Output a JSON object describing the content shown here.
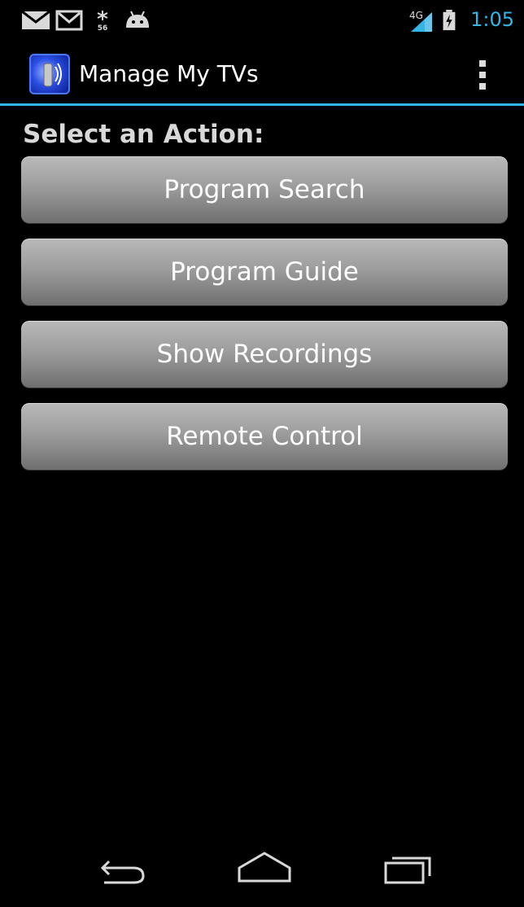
{
  "status_bar": {
    "time": "1:05",
    "network_label": "4G",
    "icons": [
      "gmail-envelope-icon",
      "gmail-m-icon",
      "weather-icon",
      "android-icon",
      "signal-icon",
      "battery-charging-icon"
    ]
  },
  "action_bar": {
    "title": "Manage My TVs",
    "app_icon": "tv-remote-app-icon",
    "overflow_icon": "overflow-menu-icon"
  },
  "main": {
    "section_title": "Select an Action:",
    "buttons": [
      {
        "label": "Program Search"
      },
      {
        "label": "Program Guide"
      },
      {
        "label": "Show Recordings"
      },
      {
        "label": "Remote Control"
      }
    ]
  },
  "nav_bar": {
    "icons": [
      "back-icon",
      "home-icon",
      "recent-apps-icon"
    ]
  },
  "colors": {
    "accent": "#33b5e5",
    "background": "#000000",
    "button_top": "#b9b9b9",
    "button_bottom": "#6f6f6f"
  }
}
